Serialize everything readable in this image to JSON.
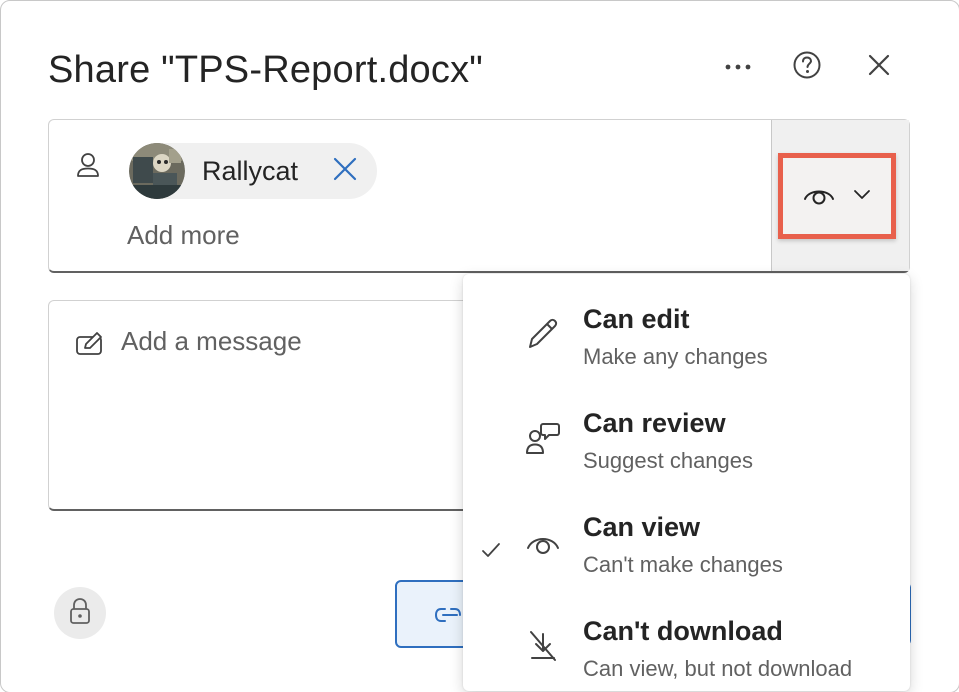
{
  "dialog": {
    "title": "Share \"TPS-Report.docx\"",
    "more_icon": "ellipsis-icon",
    "help_icon": "help-circle-icon",
    "close_icon": "close-icon"
  },
  "recipients": {
    "field_icon": "person-icon",
    "chips": [
      {
        "name": "Rallycat",
        "avatar": "photo-avatar",
        "remove_icon": "dismiss-icon"
      }
    ],
    "add_more_placeholder": "Add more",
    "permission_button": {
      "icon": "eye-icon",
      "dropdown_icon": "chevron-down-icon",
      "highlight_color": "#e8604c"
    }
  },
  "message": {
    "icon": "compose-icon",
    "placeholder": "Add a message"
  },
  "footer": {
    "settings_icon": "lock-icon",
    "copy_link_icon": "link-icon"
  },
  "permission_menu": {
    "items": [
      {
        "title": "Can edit",
        "subtitle": "Make any changes",
        "icon": "pencil-icon",
        "selected": false
      },
      {
        "title": "Can review",
        "subtitle": "Suggest changes",
        "icon": "people-comment-icon",
        "selected": false
      },
      {
        "title": "Can view",
        "subtitle": "Can't make changes",
        "icon": "eye-icon",
        "selected": true
      },
      {
        "title": "Can't download",
        "subtitle": "Can view, but not download",
        "icon": "no-download-icon",
        "selected": false
      }
    ],
    "selected_icon": "checkmark-icon"
  },
  "colors": {
    "accent": "#2f6fbf",
    "text_primary": "#242424",
    "text_secondary": "#616161"
  }
}
